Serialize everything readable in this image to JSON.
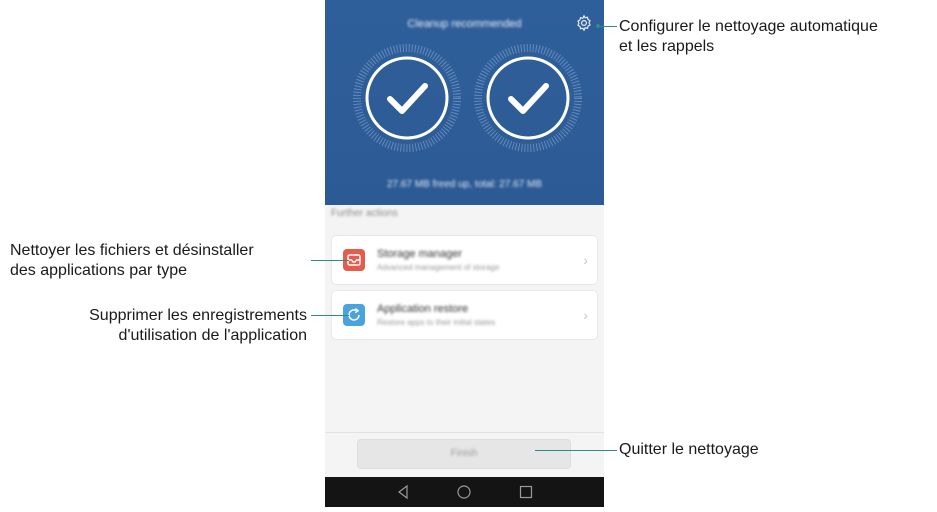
{
  "phone": {
    "header_title": "Cleanup recommended",
    "freed_text": "27.67 MB freed up, total: 27.67 MB",
    "section_label": "Further actions",
    "cards": [
      {
        "title": "Storage manager",
        "subtitle": "Advanced management of storage"
      },
      {
        "title": "Application restore",
        "subtitle": "Restore apps to their initial states"
      }
    ],
    "chevron": "›",
    "finish_label": "Finish"
  },
  "callouts": {
    "gear": [
      "Configurer le nettoyage automatique",
      "et les rappels"
    ],
    "storage": [
      "Nettoyer les fichiers et désinstaller",
      "des applications par type"
    ],
    "restore": [
      "Supprimer les enregistrements",
      "d'utilisation de l'application"
    ],
    "finish": [
      "Quitter le nettoyage"
    ]
  },
  "colors": {
    "header_blue": "#2e5d97",
    "storage_icon": "#e45c4d",
    "restore_icon": "#4aa3df",
    "leader": "#2e8c87"
  },
  "icons": {
    "gear": "gear-icon",
    "check": "checkmark-icon",
    "storage": "tray-icon",
    "restore": "refresh-icon",
    "back": "back-triangle-icon",
    "home": "home-circle-icon",
    "recent": "recent-square-icon"
  }
}
